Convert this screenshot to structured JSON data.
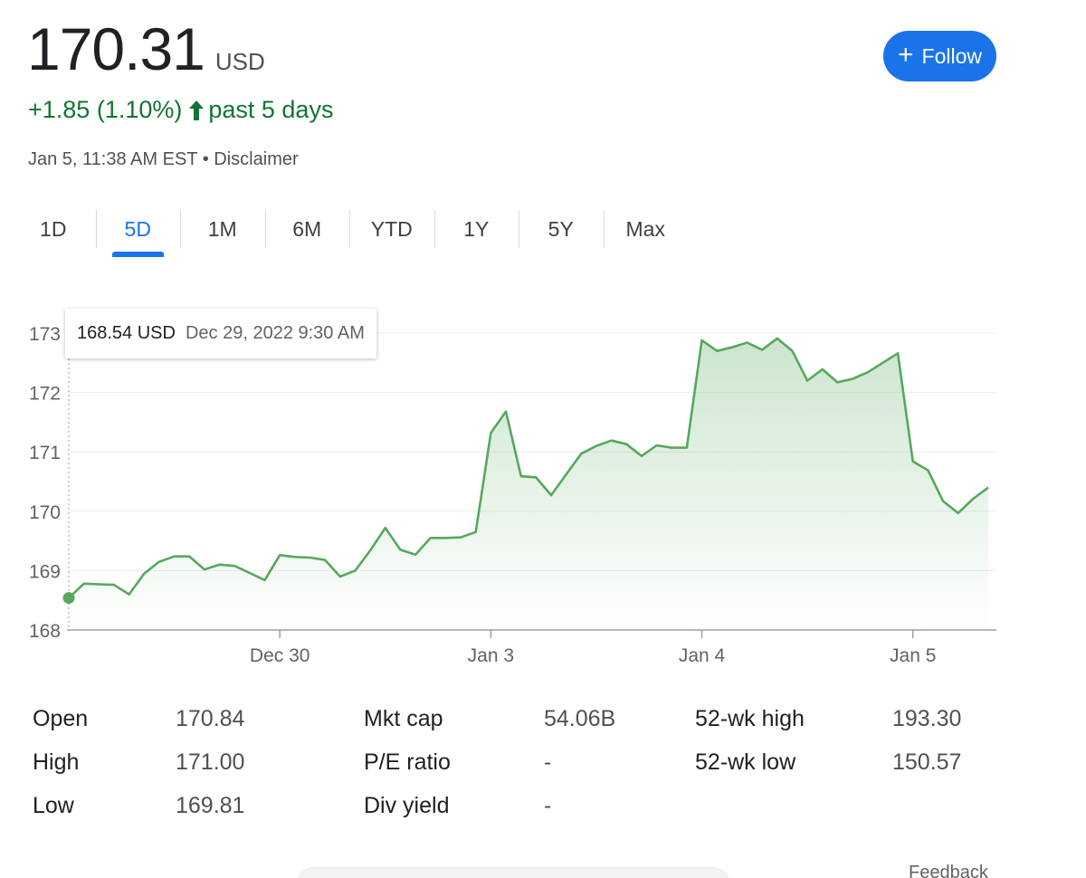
{
  "quote": {
    "price": "170.31",
    "currency": "USD",
    "change": "+1.85 (1.10%)",
    "period": "past 5 days",
    "timestamp": "Jan 5, 11:38 AM EST",
    "separator": "•",
    "disclaimer": "Disclaimer"
  },
  "follow_button": {
    "label": "Follow",
    "icon": "plus-icon",
    "color": "#1a73e8"
  },
  "tabs": [
    {
      "label": "1D"
    },
    {
      "label": "5D"
    },
    {
      "label": "1M"
    },
    {
      "label": "6M"
    },
    {
      "label": "YTD"
    },
    {
      "label": "1Y"
    },
    {
      "label": "5Y"
    },
    {
      "label": "Max"
    }
  ],
  "active_tab": "5D",
  "tooltip": {
    "value": "168.54 USD",
    "date": "Dec 29, 2022 9:30 AM"
  },
  "chart_data": {
    "type": "area",
    "ylim": [
      168,
      173
    ],
    "yticks": [
      168,
      169,
      170,
      171,
      172,
      173
    ],
    "x_ticks": [
      "Dec 30",
      "Jan 3",
      "Jan 4",
      "Jan 5"
    ],
    "line_color": "#56a85d",
    "grid": true,
    "values": [
      168.54,
      168.78,
      168.77,
      168.76,
      168.6,
      168.95,
      169.15,
      169.24,
      169.24,
      169.02,
      169.1,
      169.08,
      168.96,
      168.84,
      169.26,
      169.23,
      169.22,
      169.18,
      168.9,
      169.0,
      169.34,
      169.72,
      169.35,
      169.27,
      169.55,
      169.55,
      169.56,
      169.65,
      171.32,
      171.68,
      170.59,
      170.57,
      170.27,
      170.62,
      170.97,
      171.1,
      171.19,
      171.13,
      170.93,
      171.11,
      171.07,
      171.07,
      172.88,
      172.7,
      172.76,
      172.84,
      172.72,
      172.91,
      172.7,
      172.2,
      172.39,
      172.17,
      172.23,
      172.34,
      172.5,
      172.66,
      170.84,
      170.69,
      170.17,
      169.97,
      170.21,
      170.4
    ]
  },
  "stats": [
    {
      "label": "Open",
      "value": "170.84"
    },
    {
      "label": "High",
      "value": "171.00"
    },
    {
      "label": "Low",
      "value": "169.81"
    },
    {
      "label": "Mkt cap",
      "value": "54.06B"
    },
    {
      "label": "P/E ratio",
      "value": "-"
    },
    {
      "label": "Div yield",
      "value": "-"
    },
    {
      "label": "52-wk high",
      "value": "193.30"
    },
    {
      "label": "52-wk low",
      "value": "150.57"
    }
  ],
  "feedback": "Feedback",
  "colors": {
    "positive": "#137333",
    "accent": "#1a73e8"
  }
}
